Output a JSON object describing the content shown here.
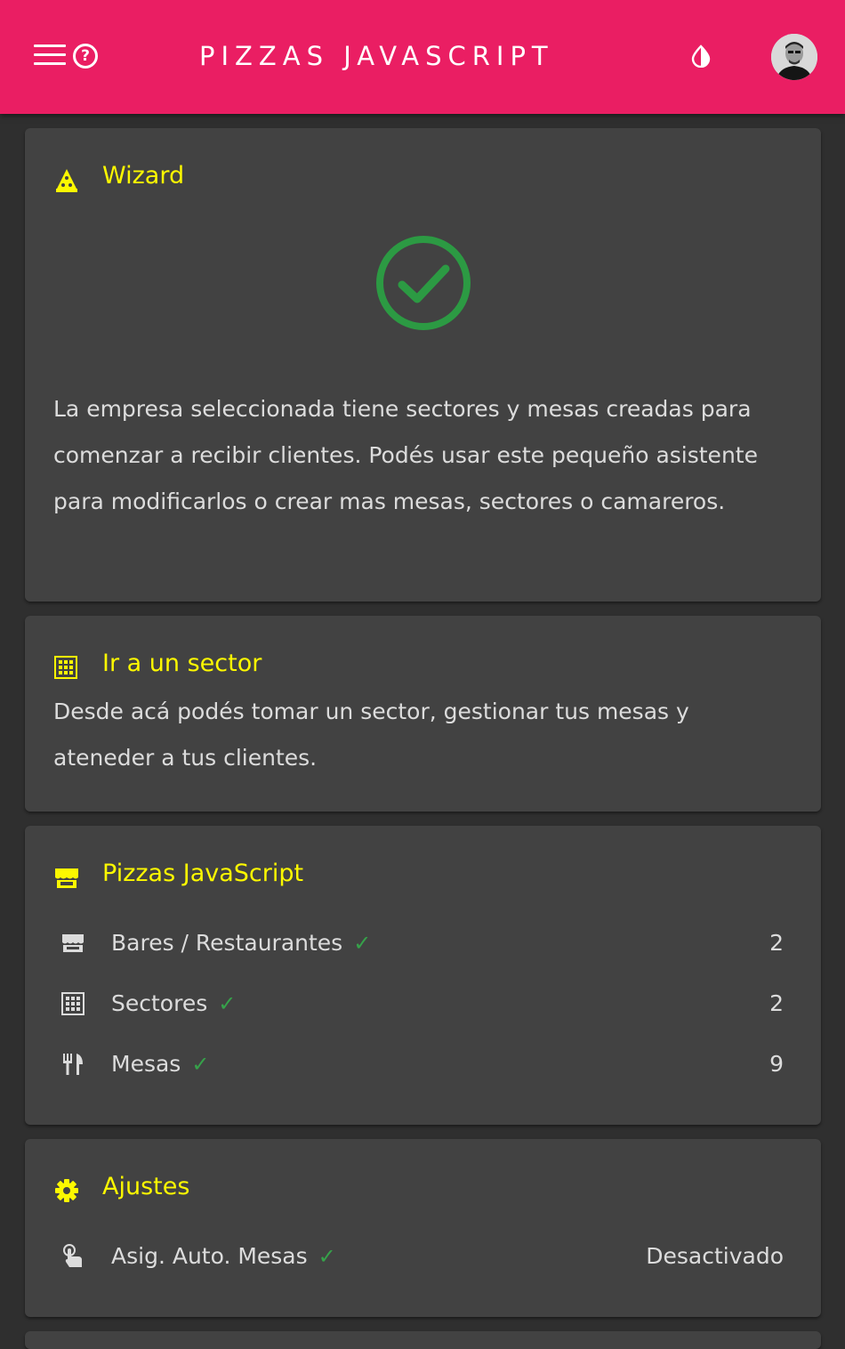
{
  "header": {
    "title": "PIZZAS JAVASCRIPT",
    "menu_icon": "hamburger-menu-icon",
    "help_icon": "help-circle-icon",
    "help_glyph": "?",
    "theme_icon": "contrast-drop-icon",
    "brand_color": "#ea1e63"
  },
  "wizard": {
    "title": "Wizard",
    "icon": "pizza-slice-icon",
    "status_icon": "check-circle-icon",
    "status_color": "#2c9a43",
    "description": "La empresa seleccionada tiene sectores y mesas creadas para comenzar a recibir clientes. Podés usar este pequeño asistente para modificarlos o crear mas mesas, sectores o camareros."
  },
  "sector": {
    "title": "Ir a un sector",
    "icon": "grid-dots-icon",
    "description": "Desde acá podés tomar un sector, gestionar tus mesas y ateneder a tus clientes."
  },
  "company": {
    "title": "Pizzas JavaScript",
    "icon": "storefront-icon",
    "items": [
      {
        "label": "Bares / Restaurantes",
        "check": "✓",
        "value": "2",
        "icon": "storefront-icon"
      },
      {
        "label": "Sectores",
        "check": "✓",
        "value": "2",
        "icon": "grid-dots-icon"
      },
      {
        "label": "Mesas",
        "check": "✓",
        "value": "9",
        "icon": "utensils-icon"
      }
    ]
  },
  "settings": {
    "title": "Ajustes",
    "icon": "gear-icon",
    "items": [
      {
        "label": "Asig. Auto. Mesas",
        "check": "✓",
        "value": "Desactivado",
        "icon": "touch-hand-icon"
      }
    ]
  },
  "colors": {
    "accent_title": "#fcf800",
    "card_bg": "#424242",
    "check": "#36a24a"
  }
}
